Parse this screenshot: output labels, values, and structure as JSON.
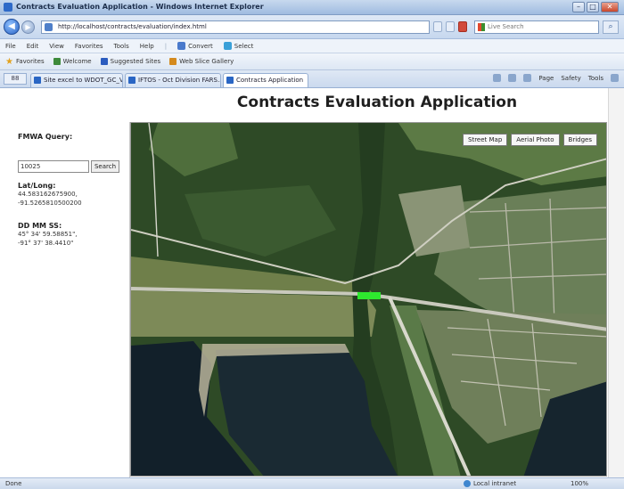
{
  "window": {
    "title": "Contracts Evaluation Application - Windows Internet Explorer",
    "minimize": "–",
    "maximize": "□",
    "close": "✕"
  },
  "address": {
    "url": "http://localhost/contracts/evaluation/index.html",
    "search_placeholder": "Live Search",
    "back_glyph": "◀",
    "forward_glyph": "▶",
    "go_glyph": "⌕"
  },
  "menu": [
    "File",
    "Edit",
    "View",
    "Favorites",
    "Tools",
    "Help"
  ],
  "toolbar": {
    "convert_label": "Convert",
    "select_label": "Select"
  },
  "favorites": {
    "label": "Favorites",
    "items": [
      "Welcome",
      "Suggested Sites",
      "Web Slice Gallery"
    ]
  },
  "tabs": {
    "list_label": "88",
    "items": [
      {
        "label": "Site excel to WDOT_GC_V..."
      },
      {
        "label": "IFTOS - Oct Division FARS..."
      },
      {
        "label": "Contracts Application"
      }
    ],
    "commands": [
      "Page",
      "Safety",
      "Tools"
    ]
  },
  "page": {
    "title": "Contracts Evaluation Application"
  },
  "sidebar": {
    "query_label": "FMWA Query:",
    "query_value": "10025",
    "search_button": "Search",
    "latlong_label": "Lat/Long:",
    "lat": "44.583162675900,",
    "long": "-91.5265810500200",
    "dms_label": "DD MM SS:",
    "dms_lat": "45° 34' 59.58851\",",
    "dms_long": "-91° 37' 38.4410\""
  },
  "map": {
    "controls": [
      "Street Map",
      "Aerial Photo",
      "Bridges"
    ]
  },
  "statusbar": {
    "status": "Done",
    "zone": "Local intranet",
    "zoom": "100%"
  },
  "colors": {
    "highlight": "#2ee82e",
    "chrome": "#c6d7ee"
  }
}
